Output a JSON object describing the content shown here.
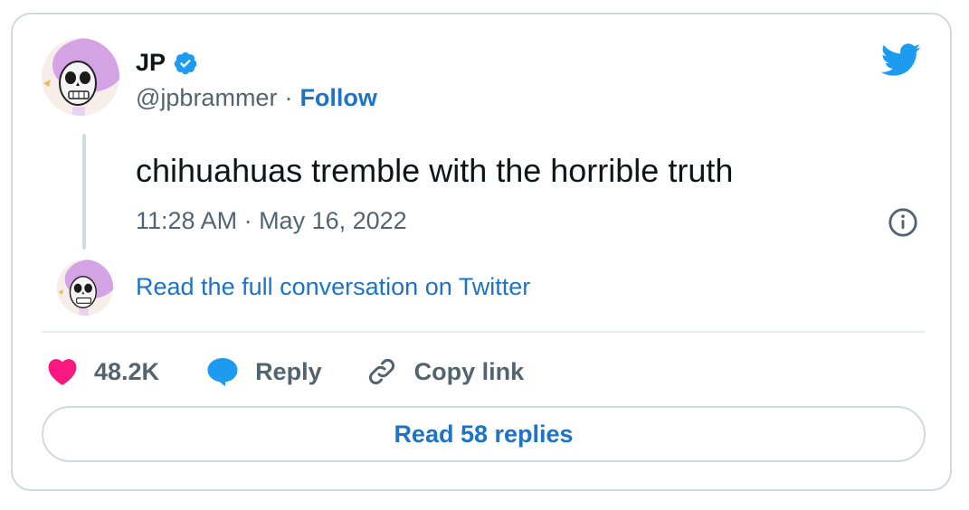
{
  "author": {
    "name": "JP",
    "handle": "@jpbrammer",
    "separator": "·",
    "follow_label": "Follow"
  },
  "tweet": {
    "text": "chihuahuas tremble with the horrible truth",
    "timestamp": "11:28 AM · May 16, 2022"
  },
  "conversation": {
    "read_full_label": "Read the full conversation on Twitter"
  },
  "actions": {
    "likes": "48.2K",
    "reply_label": "Reply",
    "copy_link_label": "Copy link"
  },
  "footer": {
    "read_replies_label": "Read 58 replies"
  },
  "icons": {
    "verified": "verified-badge-icon",
    "bird": "twitter-bird-icon",
    "info": "info-icon",
    "heart": "heart-icon",
    "reply": "speech-bubble-icon",
    "link": "link-icon"
  },
  "colors": {
    "link_blue": "#1d73c5",
    "twitter_blue": "#1d9bf0",
    "like_pink": "#f91880",
    "muted_gray": "#536471",
    "border": "#cfd9de"
  }
}
